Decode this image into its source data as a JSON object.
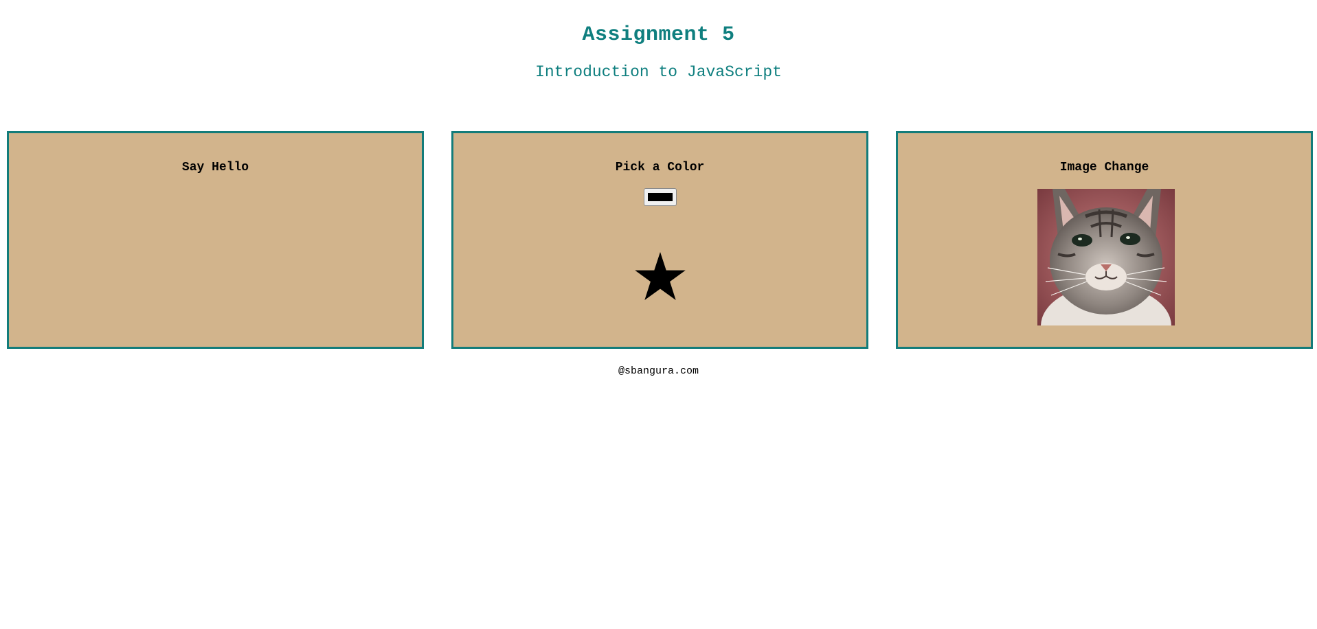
{
  "header": {
    "title": "Assignment 5",
    "subtitle": "Introduction to JavaScript"
  },
  "panels": [
    {
      "heading": "Say Hello"
    },
    {
      "heading": "Pick a Color",
      "color_picker": {
        "value": "#000000"
      },
      "shape_icon": "star-icon"
    },
    {
      "heading": "Image Change",
      "image": "cat-photo"
    }
  ],
  "footer": {
    "text": "@sbangura.com"
  },
  "colors": {
    "accent": "#0f7f7f",
    "panel_bg": "#d2b48c",
    "panel_border": "#137c7a",
    "star_fill": "#000000"
  }
}
